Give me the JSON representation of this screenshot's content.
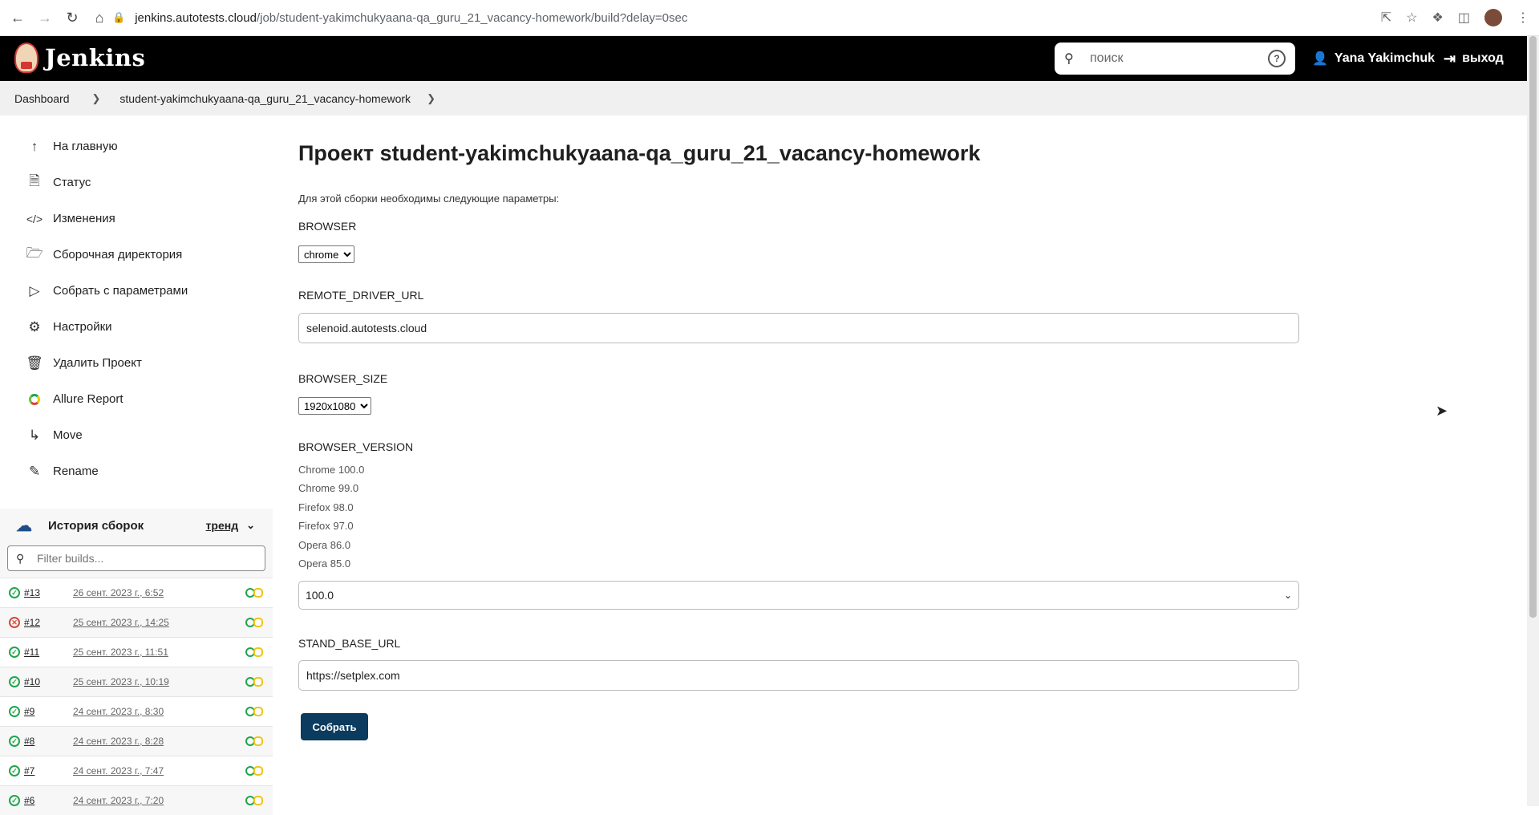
{
  "browser": {
    "url_domain": "jenkins.autotests.cloud",
    "url_path": "/job/student-yakimchukyaana-qa_guru_21_vacancy-homework/build?delay=0sec"
  },
  "header": {
    "logo_text": "Jenkins",
    "search_placeholder": "поиск",
    "help_label": "?",
    "user_name": "Yana Yakimchuk",
    "logout_label": "выход"
  },
  "breadcrumbs": {
    "dashboard": "Dashboard",
    "job": "student-yakimchukyaana-qa_guru_21_vacancy-homework"
  },
  "sidebar": {
    "items": [
      {
        "label": "На главную",
        "icon": "arrow-up-icon"
      },
      {
        "label": "Статус",
        "icon": "document-icon"
      },
      {
        "label": "Изменения",
        "icon": "code-icon"
      },
      {
        "label": "Сборочная директория",
        "icon": "folder-icon"
      },
      {
        "label": "Собрать с параметрами",
        "icon": "play-icon"
      },
      {
        "label": "Настройки",
        "icon": "gear-icon"
      },
      {
        "label": "Удалить Проект",
        "icon": "trash-icon"
      },
      {
        "label": "Allure Report",
        "icon": "allure-icon"
      },
      {
        "label": "Move",
        "icon": "move-icon"
      },
      {
        "label": "Rename",
        "icon": "pencil-icon"
      }
    ]
  },
  "history": {
    "title": "История сборок",
    "trend": "тренд",
    "filter_placeholder": "Filter builds...",
    "builds": [
      {
        "num": "#13",
        "date": "26 сент. 2023 г., 6:52",
        "status": "success"
      },
      {
        "num": "#12",
        "date": "25 сент. 2023 г., 14:25",
        "status": "failed"
      },
      {
        "num": "#11",
        "date": "25 сент. 2023 г., 11:51",
        "status": "success"
      },
      {
        "num": "#10",
        "date": "25 сент. 2023 г., 10:19",
        "status": "success"
      },
      {
        "num": "#9",
        "date": "24 сент. 2023 г., 8:30",
        "status": "success"
      },
      {
        "num": "#8",
        "date": "24 сент. 2023 г., 8:28",
        "status": "success"
      },
      {
        "num": "#7",
        "date": "24 сент. 2023 г., 7:47",
        "status": "success"
      },
      {
        "num": "#6",
        "date": "24 сент. 2023 г., 7:20",
        "status": "success"
      }
    ]
  },
  "main": {
    "title": "Проект student-yakimchukyaana-qa_guru_21_vacancy-homework",
    "intro": "Для этой сборки необходимы следующие параметры:",
    "params": {
      "browser": {
        "label": "BROWSER",
        "value": "chrome"
      },
      "remote_driver_url": {
        "label": "REMOTE_DRIVER_URL",
        "value": "selenoid.autotests.cloud"
      },
      "browser_size": {
        "label": "BROWSER_SIZE",
        "value": "1920x1080"
      },
      "browser_version": {
        "label": "BROWSER_VERSION",
        "options": [
          "Chrome 100.0",
          "Chrome 99.0",
          "Firefox 98.0",
          "Firefox 97.0",
          "Opera 86.0",
          "Opera 85.0"
        ],
        "value": "100.0"
      },
      "stand_base_url": {
        "label": "STAND_BASE_URL",
        "value": "https://setplex.com"
      }
    },
    "submit_label": "Собрать"
  }
}
